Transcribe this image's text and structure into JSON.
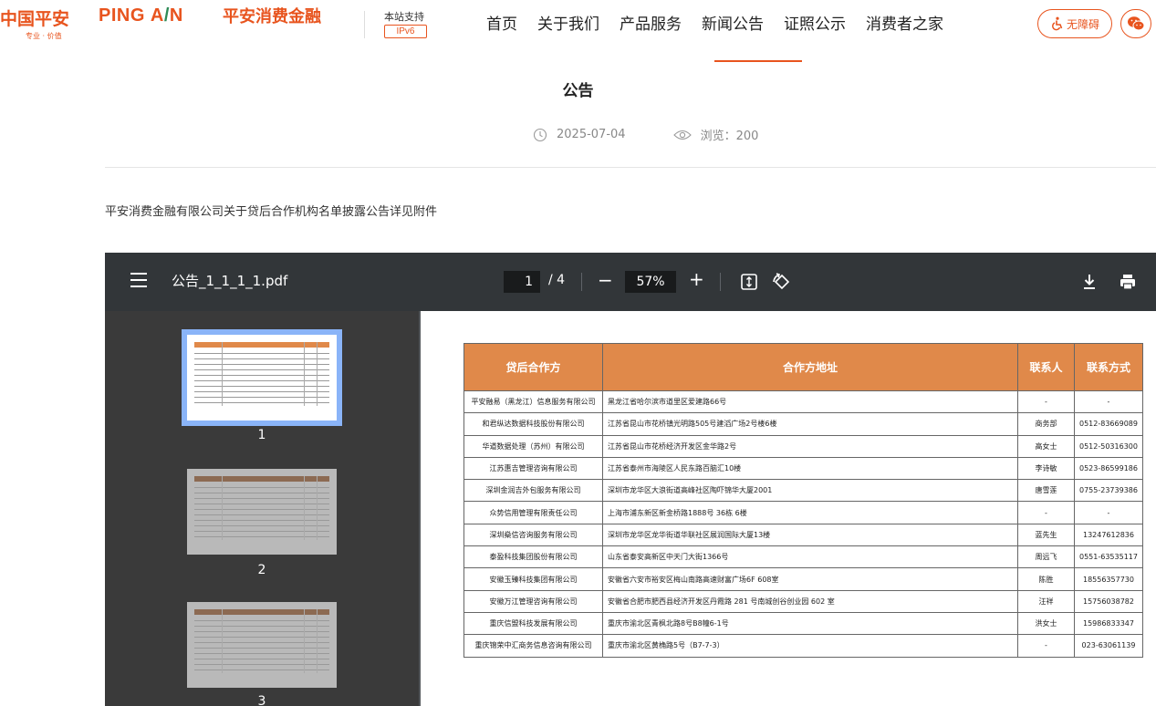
{
  "header": {
    "brand_cn": "中国平安",
    "brand_sub": "专业 · 价值",
    "brand_en": "PING AN",
    "brand_pacf": "平安消费金融",
    "ipv6_text": "本站支持",
    "ipv6_badge": "IPv6",
    "nav": [
      "首页",
      "关于我们",
      "产品服务",
      "新闻公告",
      "证照公示",
      "消费者之家"
    ],
    "active_nav": "新闻公告",
    "accessibility_label": "无障碍",
    "brand_color": "#e8541e"
  },
  "article": {
    "title": "公告",
    "date": "2025-07-04",
    "views": "浏览：200",
    "intro": "平安消费金融有限公司关于贷后合作机构名单披露公告详见附件"
  },
  "pdf": {
    "filename": "公告_1_1_1_1.pdf",
    "current_page": "1",
    "total_pages": "/ 4",
    "zoom": "57%",
    "thumbnails": [
      "1",
      "2",
      "3"
    ],
    "selected_thumbnail": "1",
    "table": {
      "headers": [
        "贷后合作方",
        "合作方地址",
        "联系人",
        "联系方式"
      ],
      "header_color": "#e0894a",
      "rows": [
        [
          "平安融易（黑龙江）信息服务有限公司",
          "黑龙江省哈尔滨市道里区爱建路66号",
          "-",
          "-"
        ],
        [
          "和君纵达数据科技股份有限公司",
          "江苏省昆山市花桥镇光明路505号建滔广场2号楼6楼",
          "商务部",
          "0512-83669089"
        ],
        [
          "华道数据处理（苏州）有限公司",
          "江苏省昆山市花桥经济开发区金华路2号",
          "高女士",
          "0512-50316300"
        ],
        [
          "江苏惠吉管理咨询有限公司",
          "江苏省泰州市海陵区人民东路百脑汇10楼",
          "李诗敏",
          "0523-86599186"
        ],
        [
          "深圳金润吉外包服务有限公司",
          "深圳市龙华区大浪街道高峰社区陶吓锦华大厦2001",
          "唐雪莲",
          "0755-23739386"
        ],
        [
          "众势信用管理有限责任公司",
          "上海市浦东新区新金桥路1888号 36栋 6楼",
          "-",
          "-"
        ],
        [
          "深圳燊信咨询服务有限公司",
          "深圳市龙华区龙华街道华联社区展润国际大厦13楼",
          "蓝先生",
          "13247612836"
        ],
        [
          "泰盈科技集团股份有限公司",
          "山东省泰安高新区中天门大街1366号",
          "周远飞",
          "0551-63535117"
        ],
        [
          "安徽玉臻科技集团有限公司",
          "安徽省六安市裕安区梅山南路高速财富广场6F 608室",
          "陈胜",
          "18556357730"
        ],
        [
          "安徽万江管理咨询有限公司",
          "安徽省合肥市肥西县经济开发区丹霞路 281 号南城创谷创业园 602 室",
          "汪祥",
          "15756038782"
        ],
        [
          "重庆信盟科技发展有限公司",
          "重庆市渝北区青枫北路8号B8幢6-1号",
          "洪女士",
          "15986833347"
        ],
        [
          "重庆锦荣中汇商务信息咨询有限公司",
          "重庆市渝北区黄桷路5号（B7-7-3）",
          "-",
          "023-63061139"
        ]
      ]
    }
  }
}
